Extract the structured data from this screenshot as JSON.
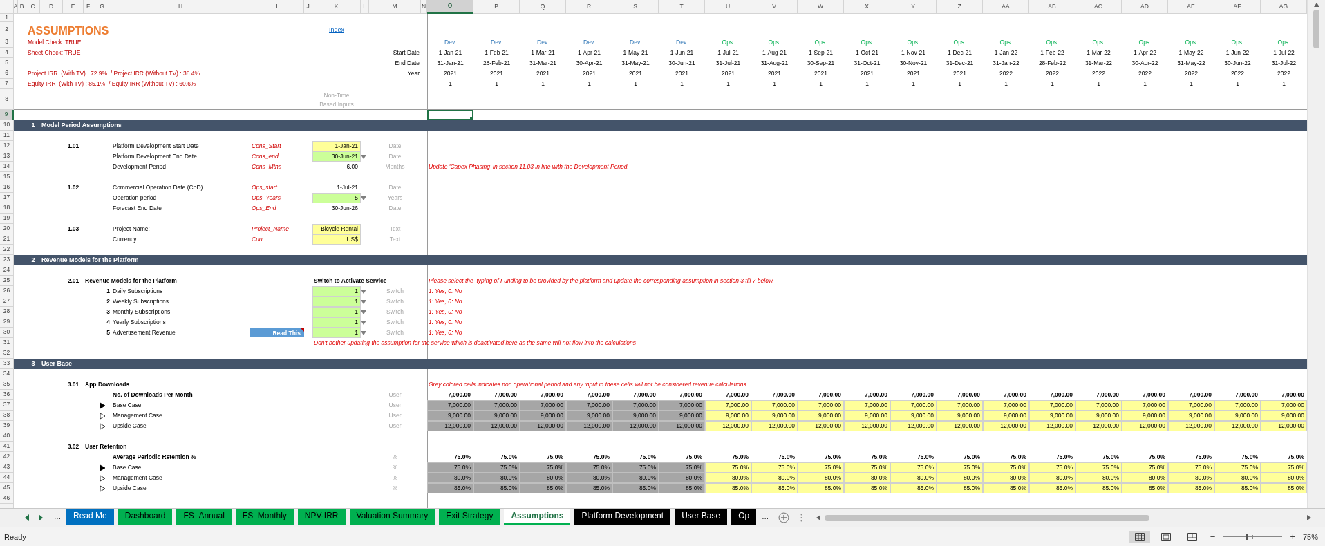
{
  "columns": [
    {
      "label": "A",
      "selected": false
    },
    {
      "label": "B",
      "selected": false
    },
    {
      "label": "C",
      "selected": false
    },
    {
      "label": "D",
      "selected": false
    },
    {
      "label": "E",
      "selected": false
    },
    {
      "label": "F",
      "selected": false
    },
    {
      "label": "G",
      "selected": false
    },
    {
      "label": "H",
      "selected": false
    },
    {
      "label": "I",
      "selected": false
    },
    {
      "label": "J",
      "selected": false
    },
    {
      "label": "K",
      "selected": false
    },
    {
      "label": "L",
      "selected": false
    },
    {
      "label": "M",
      "selected": false
    },
    {
      "label": "N",
      "selected": false
    },
    {
      "label": "O",
      "selected": true
    },
    {
      "label": "P",
      "selected": false
    },
    {
      "label": "Q",
      "selected": false
    },
    {
      "label": "R",
      "selected": false
    },
    {
      "label": "S",
      "selected": false
    },
    {
      "label": "T",
      "selected": false
    },
    {
      "label": "U",
      "selected": false
    },
    {
      "label": "V",
      "selected": false
    },
    {
      "label": "W",
      "selected": false
    },
    {
      "label": "X",
      "selected": false
    },
    {
      "label": "Y",
      "selected": false
    },
    {
      "label": "Z",
      "selected": false
    },
    {
      "label": "AA",
      "selected": false
    },
    {
      "label": "AB",
      "selected": false
    },
    {
      "label": "AC",
      "selected": false
    },
    {
      "label": "AD",
      "selected": false
    },
    {
      "label": "AE",
      "selected": false
    },
    {
      "label": "AF",
      "selected": false
    },
    {
      "label": "AG",
      "selected": false
    }
  ],
  "rows": [
    {
      "label": "1",
      "selected": false
    },
    {
      "label": "2",
      "selected": false
    },
    {
      "label": "3",
      "selected": false
    },
    {
      "label": "4",
      "selected": false
    },
    {
      "label": "5",
      "selected": false
    },
    {
      "label": "6",
      "selected": false
    },
    {
      "label": "7",
      "selected": false
    },
    {
      "label": "8",
      "selected": false
    },
    {
      "label": "9",
      "selected": true
    },
    {
      "label": "10",
      "selected": false
    },
    {
      "label": "11",
      "selected": false
    },
    {
      "label": "12",
      "selected": false
    },
    {
      "label": "13",
      "selected": false
    },
    {
      "label": "14",
      "selected": false
    },
    {
      "label": "15",
      "selected": false
    },
    {
      "label": "16",
      "selected": false
    },
    {
      "label": "17",
      "selected": false
    },
    {
      "label": "18",
      "selected": false
    },
    {
      "label": "19",
      "selected": false
    },
    {
      "label": "20",
      "selected": false
    },
    {
      "label": "21",
      "selected": false
    },
    {
      "label": "22",
      "selected": false
    },
    {
      "label": "23",
      "selected": false
    },
    {
      "label": "24",
      "selected": false
    },
    {
      "label": "25",
      "selected": false
    },
    {
      "label": "26",
      "selected": false
    },
    {
      "label": "27",
      "selected": false
    },
    {
      "label": "28",
      "selected": false
    },
    {
      "label": "29",
      "selected": false
    },
    {
      "label": "30",
      "selected": false
    },
    {
      "label": "31",
      "selected": false
    },
    {
      "label": "32",
      "selected": false
    },
    {
      "label": "33",
      "selected": false
    },
    {
      "label": "34",
      "selected": false
    },
    {
      "label": "35",
      "selected": false
    },
    {
      "label": "36",
      "selected": false
    },
    {
      "label": "37",
      "selected": false
    },
    {
      "label": "38",
      "selected": false
    },
    {
      "label": "39",
      "selected": false
    },
    {
      "label": "40",
      "selected": false
    },
    {
      "label": "41",
      "selected": false
    },
    {
      "label": "42",
      "selected": false
    },
    {
      "label": "43",
      "selected": false
    },
    {
      "label": "44",
      "selected": false
    },
    {
      "label": "45",
      "selected": false
    },
    {
      "label": "46",
      "selected": false
    }
  ],
  "title": "ASSUMPTIONS",
  "index_link": "Index",
  "checks": [
    "Model Check: TRUE",
    "Sheet Check: TRUE"
  ],
  "irr_summary": [
    "Project IRR  (With TV) : 72.9%  / Project IRR (Without TV) : 38.4%",
    "Equity IRR  (With TV) : 85.1%  / Equity IRR (Without TV) : 60.6%"
  ],
  "timeline_labels": [
    "Start Date",
    "End Date",
    "Year"
  ],
  "non_time_label": [
    "Non-Time",
    "Based Inputs"
  ],
  "periods": [
    {
      "phase": "Dev.",
      "kind": "dev",
      "start": "1-Jan-21",
      "end": "31-Jan-21",
      "year": "2021",
      "flag": "1"
    },
    {
      "phase": "Dev.",
      "kind": "dev",
      "start": "1-Feb-21",
      "end": "28-Feb-21",
      "year": "2021",
      "flag": "1"
    },
    {
      "phase": "Dev.",
      "kind": "dev",
      "start": "1-Mar-21",
      "end": "31-Mar-21",
      "year": "2021",
      "flag": "1"
    },
    {
      "phase": "Dev.",
      "kind": "dev",
      "start": "1-Apr-21",
      "end": "30-Apr-21",
      "year": "2021",
      "flag": "1"
    },
    {
      "phase": "Dev.",
      "kind": "dev",
      "start": "1-May-21",
      "end": "31-May-21",
      "year": "2021",
      "flag": "1"
    },
    {
      "phase": "Dev.",
      "kind": "dev",
      "start": "1-Jun-21",
      "end": "30-Jun-21",
      "year": "2021",
      "flag": "1"
    },
    {
      "phase": "Ops.",
      "kind": "ops",
      "start": "1-Jul-21",
      "end": "31-Jul-21",
      "year": "2021",
      "flag": "1"
    },
    {
      "phase": "Ops.",
      "kind": "ops",
      "start": "1-Aug-21",
      "end": "31-Aug-21",
      "year": "2021",
      "flag": "1"
    },
    {
      "phase": "Ops.",
      "kind": "ops",
      "start": "1-Sep-21",
      "end": "30-Sep-21",
      "year": "2021",
      "flag": "1"
    },
    {
      "phase": "Ops.",
      "kind": "ops",
      "start": "1-Oct-21",
      "end": "31-Oct-21",
      "year": "2021",
      "flag": "1"
    },
    {
      "phase": "Ops.",
      "kind": "ops",
      "start": "1-Nov-21",
      "end": "30-Nov-21",
      "year": "2021",
      "flag": "1"
    },
    {
      "phase": "Ops.",
      "kind": "ops",
      "start": "1-Dec-21",
      "end": "31-Dec-21",
      "year": "2021",
      "flag": "1"
    },
    {
      "phase": "Ops.",
      "kind": "ops",
      "start": "1-Jan-22",
      "end": "31-Jan-22",
      "year": "2022",
      "flag": "1"
    },
    {
      "phase": "Ops.",
      "kind": "ops",
      "start": "1-Feb-22",
      "end": "28-Feb-22",
      "year": "2022",
      "flag": "1"
    },
    {
      "phase": "Ops.",
      "kind": "ops",
      "start": "1-Mar-22",
      "end": "31-Mar-22",
      "year": "2022",
      "flag": "1"
    },
    {
      "phase": "Ops.",
      "kind": "ops",
      "start": "1-Apr-22",
      "end": "30-Apr-22",
      "year": "2022",
      "flag": "1"
    },
    {
      "phase": "Ops.",
      "kind": "ops",
      "start": "1-May-22",
      "end": "31-May-22",
      "year": "2022",
      "flag": "1"
    },
    {
      "phase": "Ops.",
      "kind": "ops",
      "start": "1-Jun-22",
      "end": "30-Jun-22",
      "year": "2022",
      "flag": "1"
    },
    {
      "phase": "Ops.",
      "kind": "ops",
      "start": "1-Jul-22",
      "end": "31-Jul-22",
      "year": "2022",
      "flag": "1"
    }
  ],
  "sections": [
    {
      "number": "1",
      "title": "Model Period Assumptions",
      "groups": [
        {
          "kind": "inputs",
          "ref": "1.01",
          "items": [
            {
              "label": "Platform Development Start Date",
              "range_name": "Cons_Start",
              "kind": "input",
              "value": "1-Jan-21",
              "unit": "Date"
            },
            {
              "label": "Platform Development End Date",
              "range_name": "Cons_end",
              "kind": "dropdown",
              "value": "30-Jun-21",
              "unit": "Date"
            },
            {
              "label": "Development Period",
              "range_name": "Cons_Mths",
              "kind": "calc",
              "value": "6.00",
              "unit": "Months",
              "note": "Update 'Capex Phasing' in section 11.03 in line with the Development Period."
            }
          ]
        },
        {
          "kind": "inputs",
          "ref": "1.02",
          "items": [
            {
              "label": "Commercial Operation Date (CoD)",
              "range_name": "Ops_start",
              "kind": "calc",
              "value": "1-Jul-21",
              "unit": "Date"
            },
            {
              "label": "Operation period",
              "range_name": "Ops_Years",
              "kind": "dropdown",
              "value": "5",
              "unit": "Years"
            },
            {
              "label": "Forecast End Date",
              "range_name": "Ops_End",
              "kind": "calc",
              "value": "30-Jun-26",
              "unit": "Date"
            }
          ]
        },
        {
          "kind": "inputs",
          "ref": "1.03",
          "items": [
            {
              "label": "Project Name:",
              "range_name": "Project_Name",
              "kind": "input",
              "value": "Bicycle Rental",
              "unit": "Text"
            },
            {
              "label": "Currency",
              "range_name": "Curr",
              "kind": "input",
              "value": "US$",
              "unit": "Text"
            }
          ]
        }
      ]
    },
    {
      "number": "2",
      "title": "Revenue Models for the Platform",
      "groups": [
        {
          "kind": "switches",
          "ref": "2.01",
          "title": "Revenue Models for the Platform",
          "column_heading": "Switch to Activate Service",
          "note": "Please select the  typing of Funding to be provided by the platform and update the corresponding assumption in section 3 till 7 below.",
          "footer_note": "Don't bother updating the assumption for the service which is deactivated here as the same will not flow into the calculations",
          "items": [
            {
              "number": "1",
              "label": "Daily Subscriptions",
              "value": "1",
              "unit": "Switch",
              "note": "1: Yes, 0: No"
            },
            {
              "number": "2",
              "label": "Weekly Subscriptions",
              "value": "1",
              "unit": "Switch",
              "note": "1: Yes, 0: No"
            },
            {
              "number": "3",
              "label": "Monthly Subscriptions",
              "value": "1",
              "unit": "Switch",
              "note": "1: Yes, 0: No"
            },
            {
              "number": "4",
              "label": "Yearly Subscriptions",
              "value": "1",
              "unit": "Switch",
              "note": "1: Yes, 0: No"
            },
            {
              "number": "5",
              "label": "Advertisement Revenue",
              "button": "Read This",
              "value": "1",
              "unit": "Switch",
              "note": "1: Yes, 0: No"
            }
          ]
        }
      ]
    },
    {
      "number": "3",
      "title": "User Base",
      "groups": [
        {
          "kind": "timeseries",
          "ref": "3.01",
          "title": "App Downloads",
          "note": "Grey colored cells indicates non operational period and any input in these cells will not be considered revenue calculations",
          "total": {
            "label": "No. of Downloads Per Month",
            "unit": "User",
            "values": [
              "7,000.00",
              "7,000.00",
              "7,000.00",
              "7,000.00",
              "7,000.00",
              "7,000.00",
              "7,000.00",
              "7,000.00",
              "7,000.00",
              "7,000.00",
              "7,000.00",
              "7,000.00",
              "7,000.00",
              "7,000.00",
              "7,000.00",
              "7,000.00",
              "7,000.00",
              "7,000.00",
              "7,000.00"
            ]
          },
          "cases": [
            {
              "label": "Base Case",
              "selected": true,
              "unit": "User",
              "values": [
                "7,000.00",
                "7,000.00",
                "7,000.00",
                "7,000.00",
                "7,000.00",
                "7,000.00",
                "7,000.00",
                "7,000.00",
                "7,000.00",
                "7,000.00",
                "7,000.00",
                "7,000.00",
                "7,000.00",
                "7,000.00",
                "7,000.00",
                "7,000.00",
                "7,000.00",
                "7,000.00",
                "7,000.00"
              ]
            },
            {
              "label": "Management Case",
              "selected": false,
              "unit": "User",
              "values": [
                "9,000.00",
                "9,000.00",
                "9,000.00",
                "9,000.00",
                "9,000.00",
                "9,000.00",
                "9,000.00",
                "9,000.00",
                "9,000.00",
                "9,000.00",
                "9,000.00",
                "9,000.00",
                "9,000.00",
                "9,000.00",
                "9,000.00",
                "9,000.00",
                "9,000.00",
                "9,000.00",
                "9,000.00"
              ]
            },
            {
              "label": "Upside Case",
              "selected": false,
              "unit": "User",
              "values": [
                "12,000.00",
                "12,000.00",
                "12,000.00",
                "12,000.00",
                "12,000.00",
                "12,000.00",
                "12,000.00",
                "12,000.00",
                "12,000.00",
                "12,000.00",
                "12,000.00",
                "12,000.00",
                "12,000.00",
                "12,000.00",
                "12,000.00",
                "12,000.00",
                "12,000.00",
                "12,000.00",
                "12,000.00"
              ]
            }
          ]
        },
        {
          "kind": "timeseries",
          "ref": "3.02",
          "title": "User Retention",
          "total": {
            "label": "Average Periodic Retention %",
            "unit": "%",
            "values": [
              "75.0%",
              "75.0%",
              "75.0%",
              "75.0%",
              "75.0%",
              "75.0%",
              "75.0%",
              "75.0%",
              "75.0%",
              "75.0%",
              "75.0%",
              "75.0%",
              "75.0%",
              "75.0%",
              "75.0%",
              "75.0%",
              "75.0%",
              "75.0%",
              "75.0%"
            ]
          },
          "cases": [
            {
              "label": "Base Case",
              "selected": true,
              "unit": "%",
              "values": [
                "75.0%",
                "75.0%",
                "75.0%",
                "75.0%",
                "75.0%",
                "75.0%",
                "75.0%",
                "75.0%",
                "75.0%",
                "75.0%",
                "75.0%",
                "75.0%",
                "75.0%",
                "75.0%",
                "75.0%",
                "75.0%",
                "75.0%",
                "75.0%",
                "75.0%"
              ]
            },
            {
              "label": "Management Case",
              "selected": false,
              "unit": "%",
              "values": [
                "80.0%",
                "80.0%",
                "80.0%",
                "80.0%",
                "80.0%",
                "80.0%",
                "80.0%",
                "80.0%",
                "80.0%",
                "80.0%",
                "80.0%",
                "80.0%",
                "80.0%",
                "80.0%",
                "80.0%",
                "80.0%",
                "80.0%",
                "80.0%",
                "80.0%"
              ]
            },
            {
              "label": "Upside Case",
              "selected": false,
              "unit": "%",
              "values": [
                "85.0%",
                "85.0%",
                "85.0%",
                "85.0%",
                "85.0%",
                "85.0%",
                "85.0%",
                "85.0%",
                "85.0%",
                "85.0%",
                "85.0%",
                "85.0%",
                "85.0%",
                "85.0%",
                "85.0%",
                "85.0%",
                "85.0%",
                "85.0%",
                "85.0%"
              ]
            }
          ]
        }
      ]
    }
  ],
  "tab_nav": {
    "more_left": "...",
    "more_right": "..."
  },
  "sheet_tabs": [
    {
      "label": "Read Me",
      "color": "#0070c0",
      "selected": false
    },
    {
      "label": "Dashboard",
      "color": "#00b050",
      "selected": false
    },
    {
      "label": "FS_Annual",
      "color": "#00b050",
      "selected": false
    },
    {
      "label": "FS_Monthly",
      "color": "#00b050",
      "selected": false
    },
    {
      "label": "NPV-IRR",
      "color": "#00b050",
      "selected": false
    },
    {
      "label": "Valuation Summary",
      "color": "#00b050",
      "selected": false
    },
    {
      "label": "Exit Strategy",
      "color": "#00b050",
      "selected": false
    },
    {
      "label": "Assumptions",
      "color": "#00b050",
      "selected": true
    },
    {
      "label": "Platform Development",
      "color": "#000000",
      "selected": false
    },
    {
      "label": "User Base",
      "color": "#000000",
      "selected": false
    },
    {
      "label": "Op",
      "color": "#000000",
      "selected": false
    }
  ],
  "status": "Ready",
  "views": [
    {
      "kind": "normal",
      "selected": true
    },
    {
      "kind": "page_layout",
      "selected": false
    },
    {
      "kind": "page_break",
      "selected": false
    }
  ],
  "zoom": {
    "minus": "−",
    "plus": "+",
    "level": 0.4,
    "reading": "75%"
  }
}
